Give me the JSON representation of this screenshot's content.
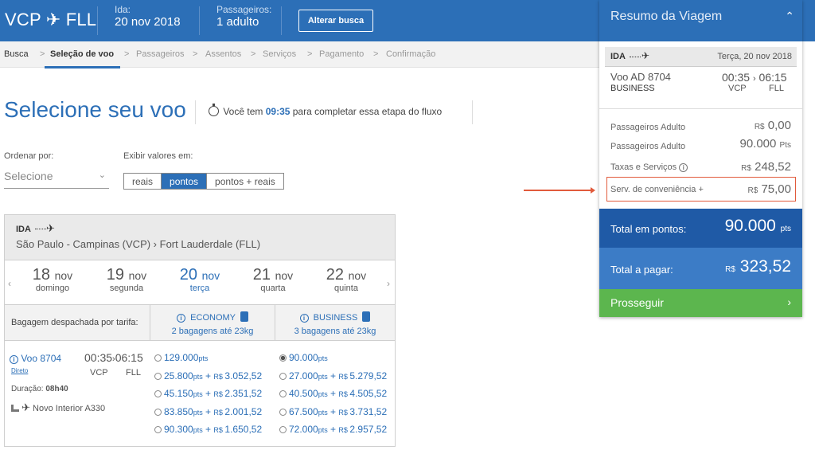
{
  "header": {
    "route": "VCP ✈ FLL",
    "ida_label": "Ida:",
    "ida_value": "20  nov  2018",
    "passengers_label": "Passageiros:",
    "passengers_value": "1 adulto",
    "change_button": "Alterar busca"
  },
  "breadcrumb": {
    "items": [
      "Busca",
      "Seleção de voo",
      "Passageiros",
      "Assentos",
      "Serviços",
      "Pagamento",
      "Confirmação"
    ],
    "separator": ">"
  },
  "page": {
    "title": "Selecione seu voo",
    "timer_prefix": "Você tem ",
    "timer_value": "09:35",
    "timer_suffix": " para completar essa etapa do fluxo",
    "sort_label": "Ordenar por:",
    "sort_placeholder": "Selecione",
    "show_values_label": "Exibir valores em:",
    "value_options": [
      "reais",
      "pontos",
      "pontos + reais"
    ],
    "value_selected": "pontos"
  },
  "flight_card": {
    "direction": "IDA",
    "route_text": "São Paulo - Campinas (VCP)  ›  Fort Lauderdale (FLL)",
    "days": [
      {
        "num": "18",
        "month": "nov",
        "weekday": "domingo",
        "active": false
      },
      {
        "num": "19",
        "month": "nov",
        "weekday": "segunda",
        "active": false
      },
      {
        "num": "20",
        "month": "nov",
        "weekday": "terça",
        "active": true
      },
      {
        "num": "21",
        "month": "nov",
        "weekday": "quarta",
        "active": false
      },
      {
        "num": "22",
        "month": "nov",
        "weekday": "quinta",
        "active": false
      }
    ],
    "bag_label": "Bagagem despachada por tarifa:",
    "fares": [
      {
        "name": "ECONOMY",
        "bags": "2 bagagens até 23kg"
      },
      {
        "name": "BUSINESS",
        "bags": "3 bagagens até 23kg"
      }
    ],
    "flight": {
      "number": "Voo 8704",
      "type": "Direto",
      "dep": "00:35",
      "arr": "06:15",
      "from": "VCP",
      "to": "FLL",
      "duration_label": "Duração:",
      "duration": "08h40",
      "aircraft": "Novo Interior A330"
    },
    "economy_options": [
      {
        "pts": "129.000",
        "brl": ""
      },
      {
        "pts": "25.800",
        "brl": "3.052,52"
      },
      {
        "pts": "45.150",
        "brl": "2.351,52"
      },
      {
        "pts": "83.850",
        "brl": "2.001,52"
      },
      {
        "pts": "90.300",
        "brl": "1.650,52"
      }
    ],
    "business_options": [
      {
        "pts": "90.000",
        "brl": "",
        "selected": true
      },
      {
        "pts": "27.000",
        "brl": "5.279,52"
      },
      {
        "pts": "40.500",
        "brl": "4.505,52"
      },
      {
        "pts": "67.500",
        "brl": "3.731,52"
      },
      {
        "pts": "72.000",
        "brl": "2.957,52"
      }
    ],
    "pts_unit": "pts",
    "plus": "+",
    "currency": "R$"
  },
  "summary": {
    "title": "Resumo da Viagem",
    "direction": "IDA",
    "date": "Terça, 20  nov 2018",
    "flight": "Voo  AD 8704",
    "class": "BUSINESS",
    "dep": "00:35",
    "arr": "06:15",
    "from": "VCP",
    "to": "FLL",
    "rows": [
      {
        "label": "Passageiros Adulto",
        "prefix": "R$",
        "value": "0,00"
      },
      {
        "label": "Passageiros Adulto",
        "prefix": "",
        "value": "90.000",
        "suffix": "Pts"
      },
      {
        "label": "Taxas e Serviços",
        "prefix": "R$",
        "value": "248,52"
      },
      {
        "label": "Serv. de conveniência +",
        "prefix": "R$",
        "value": "75,00"
      }
    ],
    "total_points_label": "Total em pontos:",
    "total_points_value": "90.000",
    "total_points_unit": "pts",
    "total_pay_label": "Total a pagar:",
    "total_pay_prefix": "R$",
    "total_pay_value": "323,52",
    "proceed_button": "Prosseguir"
  }
}
